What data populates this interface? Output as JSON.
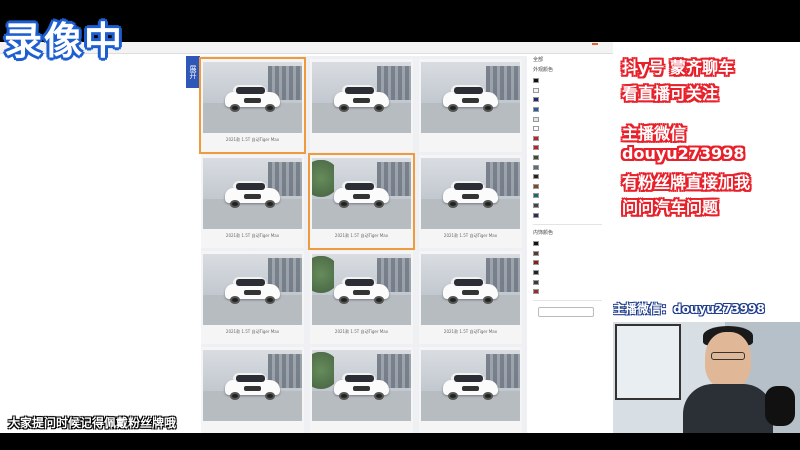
{
  "recording_label": "录像中",
  "expand_tab_label": "展开",
  "top_tag": "",
  "site_nav": [],
  "gallery": {
    "tiles": [
      {
        "caption": "2021款 1.5T 自动Tiger Max",
        "selected": true
      },
      {
        "caption": "",
        "selected": false
      },
      {
        "caption": "",
        "selected": false
      },
      {
        "caption": "2021款 1.5T 自动Tiger Max",
        "selected": false
      },
      {
        "caption": "2021款 1.5T 自动Tiger Max",
        "selected": true
      },
      {
        "caption": "2021款 1.5T 自动Tiger Max",
        "selected": false
      },
      {
        "caption": "2021款 1.5T 自动Tiger Max",
        "selected": false
      },
      {
        "caption": "2021款 1.5T 自动Tiger Max",
        "selected": false
      },
      {
        "caption": "2021款 1.5T 自动Tiger Max",
        "selected": false
      },
      {
        "caption": "",
        "selected": false
      },
      {
        "caption": "",
        "selected": false
      },
      {
        "caption": "",
        "selected": false
      }
    ]
  },
  "filters": {
    "all_label": "全部",
    "exterior_heading": "外观颜色",
    "exterior_colors": [
      {
        "label": "",
        "color": "#111111"
      },
      {
        "label": "",
        "color": "#f5f5f5"
      },
      {
        "label": "",
        "color": "#1f2d6b"
      },
      {
        "label": "",
        "color": "#2c5aa0"
      },
      {
        "label": "",
        "color": "#e6e6e6"
      },
      {
        "label": "",
        "color": "#ffffff"
      },
      {
        "label": "",
        "color": "#b3262e"
      },
      {
        "label": "",
        "color": "#c11f2a"
      },
      {
        "label": "",
        "color": "#3d4e2f"
      },
      {
        "label": "",
        "color": "#5f6a7a"
      },
      {
        "label": "",
        "color": "#222222"
      },
      {
        "label": "",
        "color": "#7a4a2a"
      },
      {
        "label": "",
        "color": "#1b6a72"
      },
      {
        "label": "",
        "color": "#444444"
      },
      {
        "label": "",
        "color": "#2a2a5c"
      }
    ],
    "interior_heading": "内饰颜色",
    "interior_colors": [
      {
        "label": "",
        "color": "#111111"
      },
      {
        "label": "",
        "color": "#5a3a2a"
      },
      {
        "label": "",
        "color": "#8a1c1c"
      },
      {
        "label": "",
        "color": "#222222"
      },
      {
        "label": "",
        "color": "#3a3a3a"
      },
      {
        "label": "",
        "color": "#9b2c2c"
      }
    ],
    "other_heading": "",
    "other_items": [],
    "button_label": ""
  },
  "caption_overlay": "大家提问时候记得佩戴粉丝牌哦",
  "promo": {
    "line1": "抖y号  蒙齐聊车",
    "line2": "看直播可关注",
    "line3": "主播微信",
    "line4": "douyu273998",
    "line5": "有粉丝牌直接加我",
    "line6": "问问汽车问题"
  },
  "webcam": {
    "monitor_overlay": "主播微信：douyu273998"
  }
}
